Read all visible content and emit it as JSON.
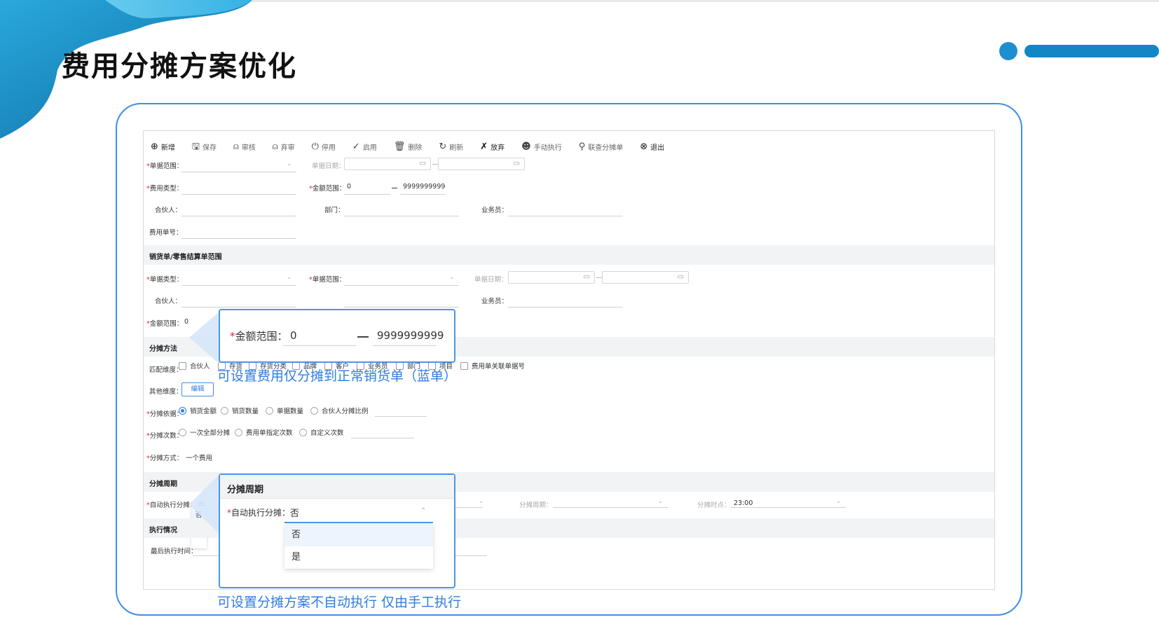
{
  "slide": {
    "title": "费用分摊方案优化",
    "accent": "#3f8ee8"
  },
  "toolbar": [
    {
      "icon": "plus-circle-icon",
      "glyph": "⊕",
      "label": "新增",
      "strong": true
    },
    {
      "icon": "save-icon",
      "glyph": "🖫",
      "label": "保存",
      "strong": false
    },
    {
      "icon": "user-audit-icon",
      "glyph": "⍝",
      "label": "审核",
      "strong": false
    },
    {
      "icon": "user-unaudit-icon",
      "glyph": "⍝",
      "label": "弃审",
      "strong": false
    },
    {
      "icon": "power-icon",
      "glyph": "⏻",
      "label": "停用",
      "strong": false
    },
    {
      "icon": "check-circle-icon",
      "glyph": "✓",
      "label": "启用",
      "strong": false
    },
    {
      "icon": "trash-icon",
      "glyph": "🗑",
      "label": "删除",
      "strong": false
    },
    {
      "icon": "refresh-icon",
      "glyph": "↻",
      "label": "刷新",
      "strong": false
    },
    {
      "icon": "discard-icon",
      "glyph": "✗",
      "label": "放弃",
      "strong": true
    },
    {
      "icon": "manual-run-icon",
      "glyph": "☻",
      "label": "手动执行",
      "strong": false
    },
    {
      "icon": "linked-query-icon",
      "glyph": "⚲",
      "label": "联查分摊单",
      "strong": false
    },
    {
      "icon": "exit-icon",
      "glyph": "⊗",
      "label": "退出",
      "strong": true
    }
  ],
  "expense": {
    "doc_range_label": "单据范围：",
    "doc_date_label": "单据日期：",
    "expense_type_label": "费用类型：",
    "amount_range_label": "金额范围：",
    "amount_from": "0",
    "amount_to": "9999999999",
    "partner_label": "合伙人：",
    "dept_label": "部门：",
    "salesman_label": "业务员：",
    "expense_no_label": "费用单号："
  },
  "sales_section": {
    "title": "销货单/零售结算单范围",
    "doc_type_label": "单据类型：",
    "doc_range_label": "单据范围：",
    "doc_date_label": "单据日期：",
    "partner_label": "合伙人：",
    "salesman_label": "业务员：",
    "amount_range_label": "金额范围：",
    "amount_from": "0"
  },
  "method_section": {
    "title": "分摊方法",
    "match_label": "匹配维度：",
    "match_options": [
      "合伙人",
      "存货",
      "存货分类",
      "品牌",
      "客户",
      "业务员",
      "部门",
      "项目",
      "费用单关联单据号"
    ],
    "other_label": "其他维度：",
    "edit_button": "编辑",
    "basis_label": "分摊依据：",
    "basis_options": [
      "销货金额",
      "销货数量",
      "单据数量",
      "合伙人分摊比例"
    ],
    "count_label": "分摊次数：",
    "count_options": [
      "一次全部分摊",
      "费用单指定次数",
      "自定义次数"
    ],
    "mode_label": "分摊方式：",
    "mode_value": "一个费用"
  },
  "period_section": {
    "title": "分摊周期",
    "auto_label": "自动执行分摊：",
    "auto_value": "否",
    "cycle_label": "分摊周期：",
    "time_label": "分摊时点：",
    "time_value": "23:00",
    "options": [
      "否",
      "是"
    ]
  },
  "exec_section": {
    "title": "执行情况",
    "last_time_label": "最后执行时间："
  },
  "callout_amount": {
    "label": "金额范围：",
    "from": "0",
    "to": "9999999999",
    "note": "可设置费用仅分摊到正常销货单（蓝单）"
  },
  "callout_period": {
    "title": "分摊周期",
    "label": "自动执行分摊：",
    "value": "否",
    "options": [
      "否",
      "是"
    ],
    "note": "可设置分摊方案不自动执行 仅由手工执行"
  }
}
